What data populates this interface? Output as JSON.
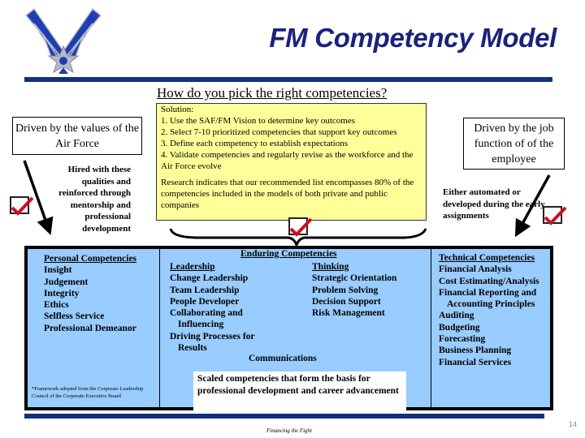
{
  "slide": {
    "title": "FM Competency Model",
    "question": "How do you pick the right competencies?",
    "page_number": "14",
    "footer": "Financing the Fight",
    "colors": {
      "title": "#1a237a",
      "rule": "#13307a",
      "solution_bg": "#ffff99",
      "table_bg": "#99ccff",
      "check": "#cc1122"
    }
  },
  "solution": {
    "heading": "Solution:",
    "steps": [
      "1.  Use the SAF/FM Vision to determine key outcomes",
      "2.  Select 7-10 prioritized competencies that support key outcomes",
      "3.  Define each competency to establish expectations",
      "4.  Validate competencies and regularly revise as the workforce and the Air Force evolve"
    ],
    "research": "Research indicates that our recommended list encompasses 80% of the competencies included in the models of both private and public companies"
  },
  "left_driver": {
    "box_text": "Driven by the values of the Air Force",
    "note": "Hired with these qualities and reinforced through mentorship and professional development"
  },
  "right_driver": {
    "box_text": "Driven by the job function of of the employee",
    "note": "Either automated or developed during the early assignments"
  },
  "personal": {
    "header": "Personal Competencies",
    "items": [
      "Insight",
      "Judgement",
      "Integrity",
      "Ethics",
      "Selfless Service",
      "Professional Demeanor"
    ]
  },
  "enduring": {
    "header": "Enduring Competencies",
    "leadership": {
      "header": "Leadership",
      "items": [
        "Change Leadership",
        "Team Leadership",
        "People Developer",
        "Collaborating and",
        "Influencing",
        "Driving Processes for",
        "Results"
      ]
    },
    "thinking": {
      "header": "Thinking",
      "items": [
        "Strategic Orientation",
        "Problem Solving",
        "Decision Support",
        "Risk Management"
      ]
    },
    "communications": "Communications",
    "scaled_note": "Scaled competencies that form the basis for professional development and career advancement"
  },
  "technical": {
    "header": "Technical Competencies",
    "items": [
      "Financial Analysis",
      "Cost Estimating/Analysis",
      "Financial Reporting and",
      "Accounting Principles",
      "Auditing",
      "Budgeting",
      "Forecasting",
      "Business Planning",
      "Financial Services"
    ]
  },
  "footnote": "*Framework adopted from the Corporate Leadership Council of the Corporate Executive Board",
  "icons": {
    "logo": "air-force-wings-logo",
    "check": "checkmark-icon",
    "arrow": "arrow-icon",
    "brace": "curly-brace-icon"
  }
}
